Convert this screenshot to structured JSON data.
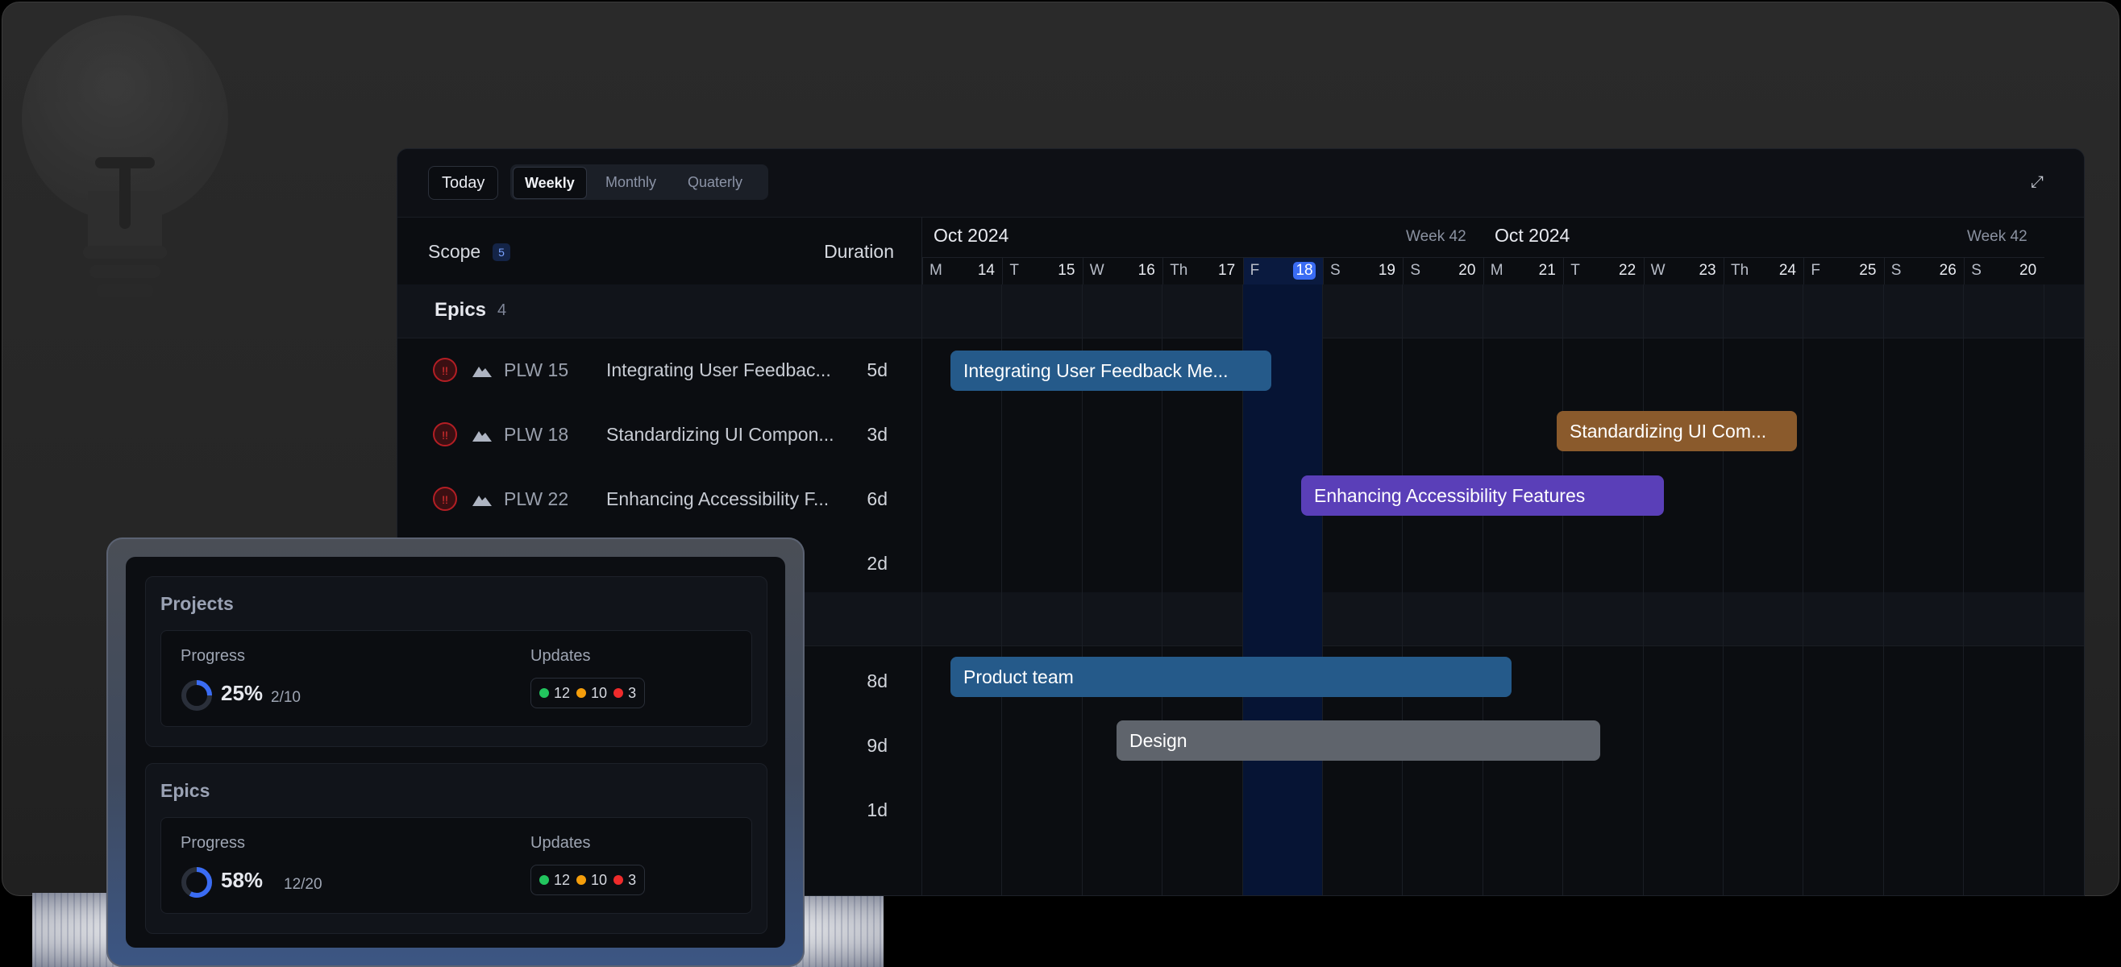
{
  "toolbar": {
    "today_label": "Today",
    "views": [
      "Weekly",
      "Monthly",
      "Quaterly"
    ],
    "active_view": "Weekly"
  },
  "left_header": {
    "scope_label": "Scope",
    "scope_count": "5",
    "duration_label": "Duration"
  },
  "calendar": {
    "months": [
      {
        "label": "Oct 2024",
        "week": "Week 42"
      },
      {
        "label": "Oct 2024",
        "week": "Week 42"
      }
    ],
    "days": [
      {
        "l": "M",
        "n": "14"
      },
      {
        "l": "T",
        "n": "15"
      },
      {
        "l": "W",
        "n": "16"
      },
      {
        "l": "Th",
        "n": "17"
      },
      {
        "l": "F",
        "n": "18"
      },
      {
        "l": "S",
        "n": "19"
      },
      {
        "l": "S",
        "n": "20"
      },
      {
        "l": "M",
        "n": "21"
      },
      {
        "l": "T",
        "n": "22"
      },
      {
        "l": "W",
        "n": "23"
      },
      {
        "l": "Th",
        "n": "24"
      },
      {
        "l": "F",
        "n": "25"
      },
      {
        "l": "S",
        "n": "26"
      },
      {
        "l": "S",
        "n": "20"
      }
    ],
    "today_day": "18"
  },
  "groups": [
    {
      "label": "Epics",
      "count": "4"
    }
  ],
  "rows": [
    {
      "key": "PLW 15",
      "title": "Integrating User Feedbac...",
      "duration": "5d"
    },
    {
      "key": "PLW 18",
      "title": "Standardizing UI Compon...",
      "duration": "3d"
    },
    {
      "key": "PLW 22",
      "title": "Enhancing Accessibility F...",
      "duration": "6d"
    },
    {
      "key": "",
      "title": "",
      "duration": "2d"
    },
    {
      "key": "",
      "title": "",
      "duration": "8d"
    },
    {
      "key": "",
      "title": "",
      "duration": "9d"
    },
    {
      "key": "",
      "title": "",
      "duration": "1d"
    }
  ],
  "bars": [
    {
      "label": "Integrating User Feedback Me...",
      "color": "#255a8a"
    },
    {
      "label": "Standardizing UI Com...",
      "color": "#8a5a2c"
    },
    {
      "label": "Enhancing Accessibility Features",
      "color": "#5a3fb8"
    },
    {
      "label": "Product team",
      "color": "#255a8a"
    },
    {
      "label": "Design",
      "color": "#5f646c"
    }
  ],
  "summary": {
    "projects": {
      "title": "Projects",
      "progress_label": "Progress",
      "percent": "25%",
      "fraction": "2/10",
      "progress_value": 0.25,
      "updates_label": "Updates",
      "updates": {
        "green": "12",
        "orange": "10",
        "red": "3"
      }
    },
    "epics": {
      "title": "Epics",
      "progress_label": "Progress",
      "percent": "58%",
      "fraction": "12/20",
      "progress_value": 0.58,
      "updates_label": "Updates",
      "updates": {
        "green": "12",
        "orange": "10",
        "red": "3"
      }
    }
  },
  "colors": {
    "accent": "#3a6cf4",
    "status_green": "#22c55e",
    "status_orange": "#f59e0b",
    "status_red": "#ef2b2b"
  }
}
